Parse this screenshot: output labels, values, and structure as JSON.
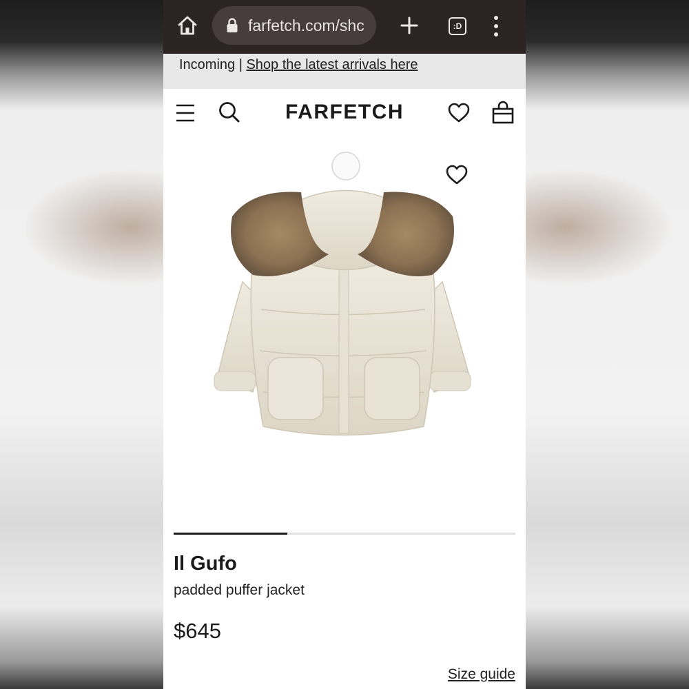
{
  "browser": {
    "url": "farfetch.com/shc",
    "tab_count_label": ":D"
  },
  "banner": {
    "prefix": "Incoming | ",
    "link": "Shop the latest arrivals here"
  },
  "header": {
    "logo": "FARFETCH"
  },
  "carousel": {
    "active_fraction": 0.333
  },
  "product": {
    "brand": "Il Gufo",
    "name": "padded puffer jacket",
    "price": "$645",
    "size_guide": "Size guide"
  },
  "icons": {
    "browser": [
      "home-icon",
      "lock-icon",
      "new-tab-icon",
      "tab-switcher-icon",
      "more-options-icon"
    ],
    "header": [
      "hamburger-menu-icon",
      "search-icon",
      "wishlist-heart-icon",
      "shopping-bag-icon"
    ],
    "image": [
      "add-to-wishlist-heart-icon"
    ]
  },
  "colors": {
    "chrome_bg": "#2b2423",
    "url_pill": "#463d3c",
    "banner_bg": "#e8e8e8",
    "text": "#1a1a1a"
  }
}
